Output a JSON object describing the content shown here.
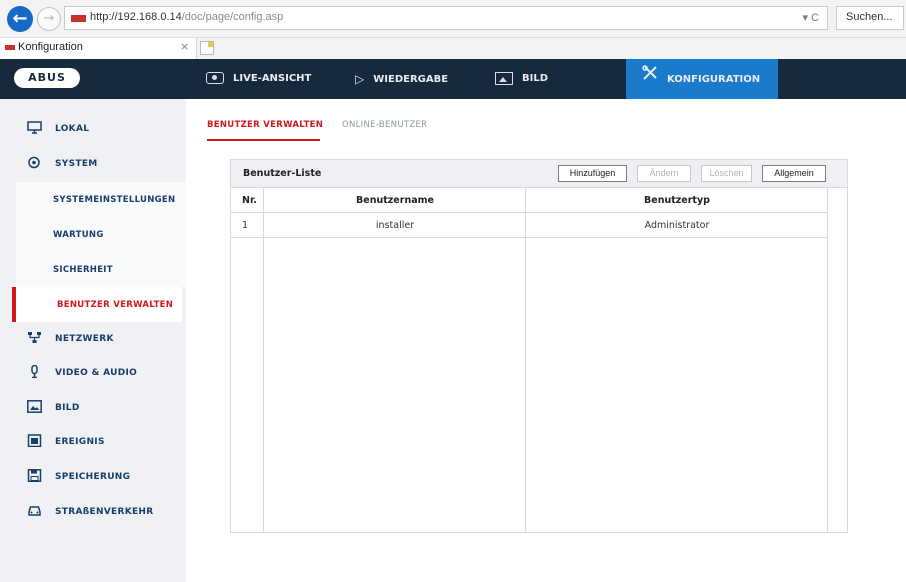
{
  "browser": {
    "url_host": "http://192.168.0.14",
    "url_path": "/doc/page/config.asp",
    "url_tools": "▾ C",
    "search_placeholder": "Suchen...",
    "tab_title": "Konfiguration",
    "tab_close": "×"
  },
  "header": {
    "logo": "ABUS",
    "nav": {
      "live": "LIVE-ANSICHT",
      "playback": "WIEDERGABE",
      "image": "BILD",
      "config": "KONFIGURATION"
    }
  },
  "sidebar": {
    "lokal": "LOKAL",
    "system": "SYSTEM",
    "system_sub": {
      "settings": "SYSTEMEINSTELLUNGEN",
      "maintenance": "WARTUNG",
      "security": "SICHERHEIT",
      "users": "BENUTZER VERWALTEN"
    },
    "network": "NETZWERK",
    "video_audio": "VIDEO & AUDIO",
    "image": "BILD",
    "event": "EREIGNIS",
    "storage": "SPEICHERUNG",
    "traffic": "STRAßENVERKEHR"
  },
  "subtabs": {
    "users": "BENUTZER VERWALTEN",
    "online": "ONLINE-BENUTZER"
  },
  "panel": {
    "title": "Benutzer-Liste",
    "buttons": {
      "add": "Hinzufügen",
      "edit": "Ändern",
      "delete": "Löschen",
      "general": "Allgemein"
    },
    "columns": {
      "nr": "Nr.",
      "username": "Benutzername",
      "usertype": "Benutzertyp"
    },
    "rows": [
      {
        "nr": "1",
        "username": "installer",
        "usertype": "Administrator"
      }
    ]
  },
  "colors": {
    "header_bg": "#17293c",
    "active_nav": "#1a7acb",
    "accent_red": "#d0171d",
    "sidebar_bg": "#eff1f4"
  }
}
